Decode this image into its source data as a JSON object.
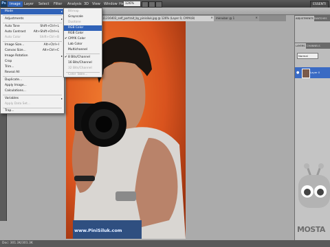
{
  "menubar": {
    "logo": "Ps",
    "items": [
      "Image",
      "Layer",
      "Select",
      "Filter",
      "Analysis",
      "3D",
      "View",
      "Window",
      "Help"
    ],
    "zoom": "126%",
    "workspace_label": "ESSENTI"
  },
  "document_tabs": [
    {
      "label": "11216403_self_portrait_by_pinisiluk.jpg @ 126% (Layer 0, CMYK/8)",
      "close": "×"
    },
    {
      "label": "menubar @ 1",
      "close": "×"
    }
  ],
  "image_menu": {
    "items": [
      {
        "label": "Mode",
        "shortcut": "",
        "submenu": true,
        "highlighted": true
      },
      {
        "label": "Adjustments",
        "shortcut": "",
        "submenu": true
      },
      {
        "label": "Auto Tone",
        "shortcut": "Shift+Ctrl+L"
      },
      {
        "label": "Auto Contrast",
        "shortcut": "Alt+Shift+Ctrl+L"
      },
      {
        "label": "Auto Color",
        "shortcut": "Shift+Ctrl+B",
        "disabled": true
      },
      {
        "label": "Image Size...",
        "shortcut": "Alt+Ctrl+I"
      },
      {
        "label": "Canvas Size...",
        "shortcut": "Alt+Ctrl+C"
      },
      {
        "label": "Image Rotation",
        "shortcut": "",
        "submenu": true
      },
      {
        "label": "Crop",
        "shortcut": ""
      },
      {
        "label": "Trim...",
        "shortcut": ""
      },
      {
        "label": "Reveal All",
        "shortcut": ""
      },
      {
        "label": "Duplicate...",
        "shortcut": ""
      },
      {
        "label": "Apply Image...",
        "shortcut": ""
      },
      {
        "label": "Calculations...",
        "shortcut": ""
      },
      {
        "label": "Variables",
        "shortcut": "",
        "submenu": true
      },
      {
        "label": "Apply Data Set...",
        "shortcut": "",
        "disabled": true
      },
      {
        "label": "Trap...",
        "shortcut": ""
      }
    ],
    "arrow": "▸"
  },
  "mode_submenu": {
    "items": [
      {
        "label": "Bitmap",
        "disabled": true
      },
      {
        "label": "Grayscale"
      },
      {
        "label": "Duotone",
        "disabled": true
      },
      {
        "label": "RGB Color",
        "highlighted": true
      },
      {
        "label": "RGB Color"
      },
      {
        "label": "CMYK Color",
        "checked": true
      },
      {
        "label": "Lab Color"
      },
      {
        "label": "Multichannel"
      },
      {
        "label": "8 Bits/Channel",
        "checked": true
      },
      {
        "label": "16 Bits/Channel"
      },
      {
        "label": "32 Bits/Channel",
        "disabled": true
      },
      {
        "label": "Color Table...",
        "disabled": true
      }
    ],
    "check": "✔"
  },
  "right_panel": {
    "top_tabs": [
      "ADJUSTMENTS",
      "SWATCHES"
    ],
    "bottom_tabs": [
      "LAYERS",
      "CHANNELS"
    ],
    "blend_mode": "Normal",
    "layer_name": "Layer 0",
    "eye": "●"
  },
  "canvas": {
    "watermark": "www.PiniSiluk.com"
  },
  "status": {
    "text": "Doc: 301.3K/301.3K"
  },
  "logo": {
    "text": "MOSTA"
  },
  "colors": {
    "menu_highlight": "#2f62b8",
    "photo_background": "#d9531e",
    "workspace": "#ababab"
  }
}
